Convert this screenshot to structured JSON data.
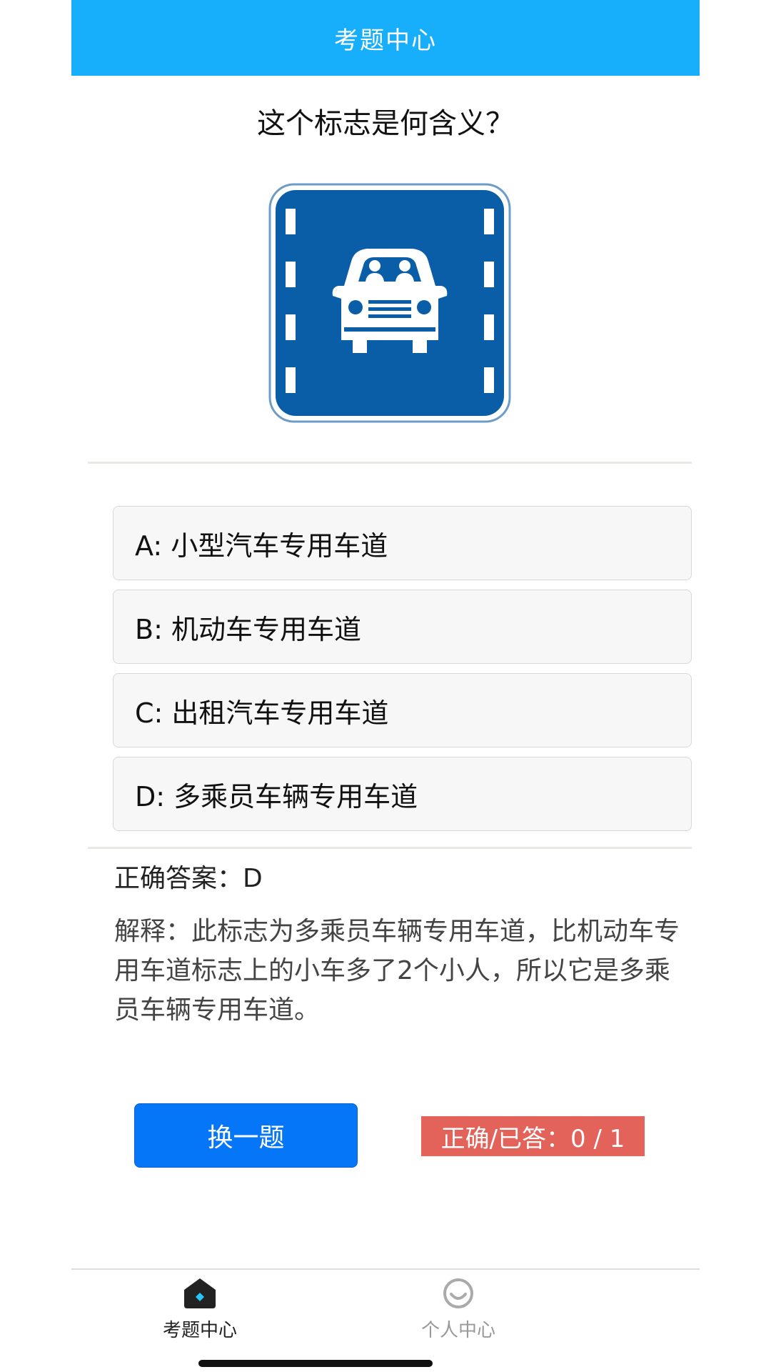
{
  "header": {
    "title": "考题中心"
  },
  "question": {
    "text": "这个标志是何含义？"
  },
  "sign": {
    "icon": "car-lane-sign-icon",
    "bg_color": "#0a5ea8"
  },
  "options": [
    {
      "label": "A: 小型汽车专用车道"
    },
    {
      "label": "B: 机动车专用车道"
    },
    {
      "label": "C: 出租汽车专用车道"
    },
    {
      "label": "D: 多乘员车辆专用车道"
    }
  ],
  "result": {
    "answer": "正确答案：D",
    "explanation": "解释：此标志为多乘员车辆专用车道，比机动车专用车道标志上的小车多了2个小人，所以它是多乘员车辆专用车道。"
  },
  "actions": {
    "next_label": "换一题",
    "score_label": "正确/已答：0 / 1"
  },
  "tabbar": {
    "items": [
      {
        "label": "考题中心",
        "icon": "home-icon",
        "active": true
      },
      {
        "label": "个人中心",
        "icon": "smiley-icon",
        "active": false
      }
    ],
    "active_color": "#222222",
    "inactive_color": "#999999",
    "accent": "#29c5f6"
  }
}
